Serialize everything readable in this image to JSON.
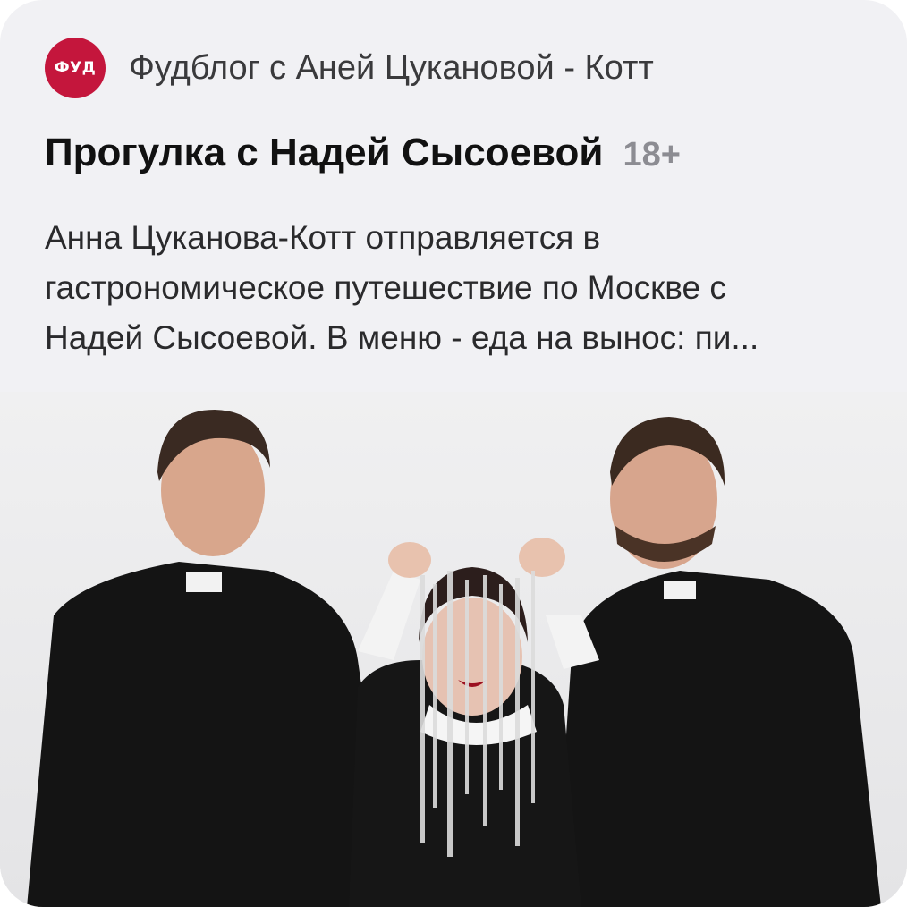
{
  "channel": {
    "avatar_text": "ФУД",
    "name": "Фудблог с Аней Цукановой - Котт",
    "avatar_color": "#c4163c"
  },
  "post": {
    "title": "Прогулка с Надей Сысоевой",
    "age_rating": "18+",
    "description_lines": [
      "Анна Цуканова-Котт отправляется в",
      "гастрономическое путешествие по Москве с",
      "Надей Сысоевой. В меню - еда на вынос: пи..."
    ]
  },
  "photo": {
    "description": "photo-preview"
  }
}
